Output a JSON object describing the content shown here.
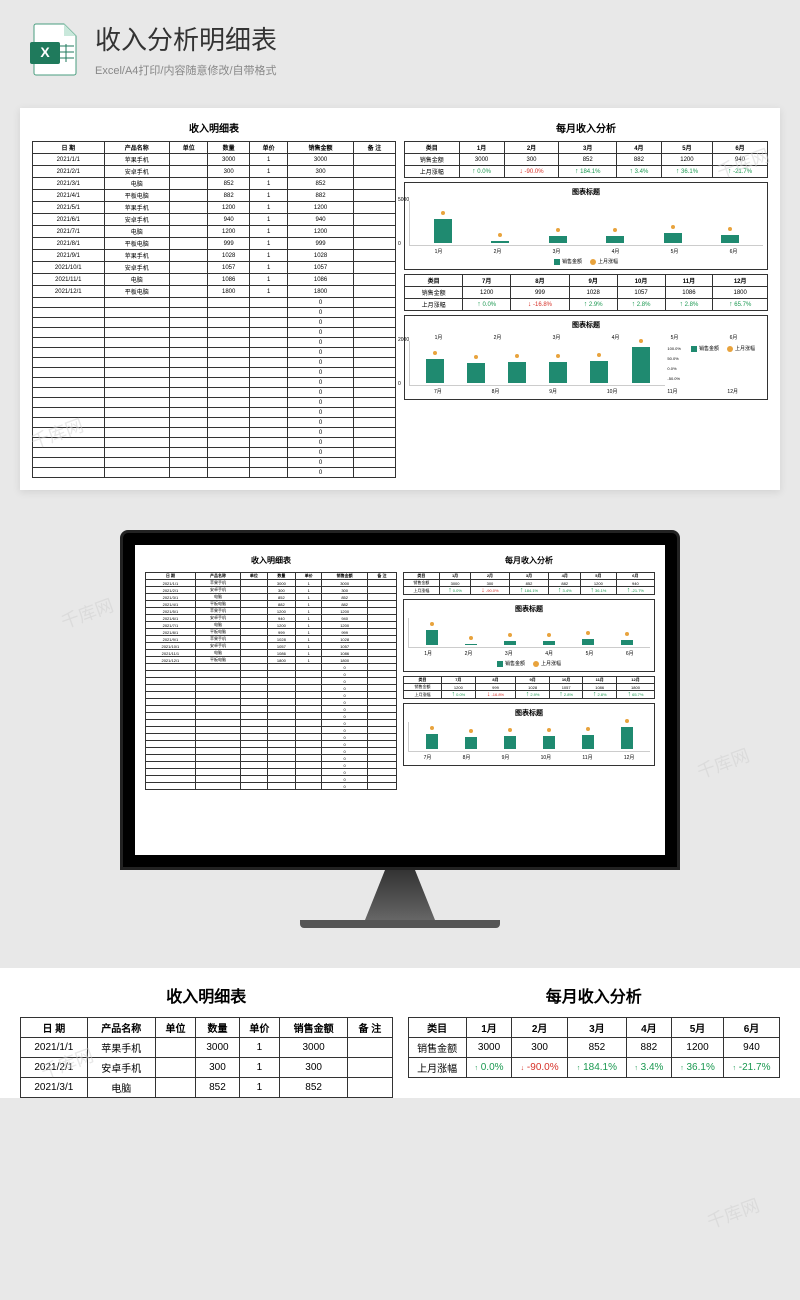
{
  "header": {
    "title": "收入分析明细表",
    "subtitle": "Excel/A4打印/内容随意修改/自带格式"
  },
  "watermark": "千库网",
  "detail": {
    "title": "收入明细表",
    "columns": [
      "日 期",
      "产品名称",
      "单位",
      "数量",
      "单价",
      "销售金额",
      "备 注"
    ],
    "rows": [
      [
        "2021/1/1",
        "苹果手机",
        "",
        "3000",
        "1",
        "3000",
        ""
      ],
      [
        "2021/2/1",
        "安卓手机",
        "",
        "300",
        "1",
        "300",
        ""
      ],
      [
        "2021/3/1",
        "电脑",
        "",
        "852",
        "1",
        "852",
        ""
      ],
      [
        "2021/4/1",
        "平板电脑",
        "",
        "882",
        "1",
        "882",
        ""
      ],
      [
        "2021/5/1",
        "苹果手机",
        "",
        "1200",
        "1",
        "1200",
        ""
      ],
      [
        "2021/6/1",
        "安卓手机",
        "",
        "940",
        "1",
        "940",
        ""
      ],
      [
        "2021/7/1",
        "电脑",
        "",
        "1200",
        "1",
        "1200",
        ""
      ],
      [
        "2021/8/1",
        "平板电脑",
        "",
        "999",
        "1",
        "999",
        ""
      ],
      [
        "2021/9/1",
        "苹果手机",
        "",
        "1028",
        "1",
        "1028",
        ""
      ],
      [
        "2021/10/1",
        "安卓手机",
        "",
        "1057",
        "1",
        "1057",
        ""
      ],
      [
        "2021/11/1",
        "电脑",
        "",
        "1086",
        "1",
        "1086",
        ""
      ],
      [
        "2021/12/1",
        "平板电脑",
        "",
        "1800",
        "1",
        "1800",
        ""
      ]
    ],
    "zero_rows": 18
  },
  "analysis": {
    "title": "每月收入分析",
    "table1": {
      "header": [
        "类目",
        "1月",
        "2月",
        "3月",
        "4月",
        "5月",
        "6月"
      ],
      "row1_label": "销售金额",
      "row1": [
        "3000",
        "300",
        "852",
        "882",
        "1200",
        "940"
      ],
      "row2_label": "上月涨幅",
      "row2": [
        {
          "v": "0.0%",
          "d": "up"
        },
        {
          "v": "-90.0%",
          "d": "down"
        },
        {
          "v": "184.1%",
          "d": "up"
        },
        {
          "v": "3.4%",
          "d": "up"
        },
        {
          "v": "36.1%",
          "d": "up"
        },
        {
          "v": "-21.7%",
          "d": "up"
        }
      ]
    },
    "table2": {
      "header": [
        "类目",
        "7月",
        "8月",
        "9月",
        "10月",
        "11月",
        "12月"
      ],
      "row1_label": "销售金额",
      "row1": [
        "1200",
        "999",
        "1028",
        "1057",
        "1086",
        "1800"
      ],
      "row2_label": "上月涨幅",
      "row2": [
        {
          "v": "0.0%",
          "d": "up"
        },
        {
          "v": "-16.8%",
          "d": "down"
        },
        {
          "v": "2.9%",
          "d": "up"
        },
        {
          "v": "2.8%",
          "d": "up"
        },
        {
          "v": "2.8%",
          "d": "up"
        },
        {
          "v": "65.7%",
          "d": "up"
        }
      ]
    },
    "chart_title": "图表标题",
    "legend": {
      "bar": "销售金额",
      "dot": "上月涨幅"
    },
    "chart2_extra_labels": [
      "1月",
      "2月",
      "3月",
      "4月",
      "5月",
      "6月"
    ],
    "chart2_yaxis": [
      "100.0%",
      "50.0%",
      "0.0%",
      "-50.0%"
    ]
  },
  "chart_data": [
    {
      "type": "bar",
      "title": "图表标题",
      "categories": [
        "1月",
        "2月",
        "3月",
        "4月",
        "5月",
        "6月"
      ],
      "series": [
        {
          "name": "销售金额",
          "values": [
            3000,
            300,
            852,
            882,
            1200,
            940
          ]
        },
        {
          "name": "上月涨幅",
          "values": [
            0.0,
            -90.0,
            184.1,
            3.4,
            36.1,
            -21.7
          ]
        }
      ],
      "ylim": [
        0,
        5000
      ]
    },
    {
      "type": "bar",
      "title": "图表标题",
      "categories": [
        "7月",
        "8月",
        "9月",
        "10月",
        "11月",
        "12月"
      ],
      "series": [
        {
          "name": "销售金额",
          "values": [
            1200,
            999,
            1028,
            1057,
            1086,
            1800
          ]
        },
        {
          "name": "上月涨幅",
          "values": [
            0.0,
            -16.8,
            2.9,
            2.8,
            2.8,
            65.7
          ]
        }
      ],
      "ylim": [
        0,
        2000
      ]
    }
  ]
}
